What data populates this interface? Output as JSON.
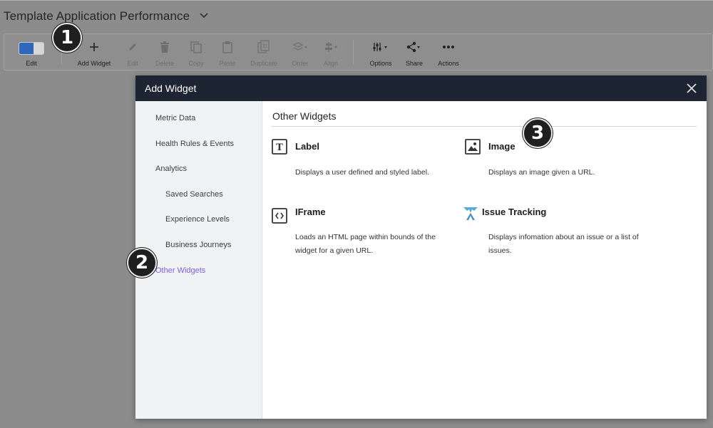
{
  "page": {
    "title": "Template Application Performance"
  },
  "toolbar": {
    "edit_label": "Edit",
    "add_widget_label": "Add Widget",
    "edit2_label": "Edit",
    "delete_label": "Delete",
    "copy_label": "Copy",
    "paste_label": "Paste",
    "duplicate_label": "Duplicate",
    "order_label": "Order",
    "align_label": "Align",
    "options_label": "Options",
    "share_label": "Share",
    "actions_label": "Actions"
  },
  "modal": {
    "title": "Add Widget",
    "sidebar": {
      "items": [
        {
          "label": "Metric Data"
        },
        {
          "label": "Health Rules & Events"
        },
        {
          "label": "Analytics"
        },
        {
          "label": "Saved Searches"
        },
        {
          "label": "Experience Levels"
        },
        {
          "label": "Business Journeys"
        },
        {
          "label": "Other Widgets",
          "active": true
        }
      ]
    },
    "section_title": "Other Widgets",
    "widgets": [
      {
        "name": "Label",
        "icon": "label-icon",
        "desc": "Displays a user defined and styled label."
      },
      {
        "name": "Image",
        "icon": "image-icon",
        "desc": "Displays an image given a URL."
      },
      {
        "name": "IFrame",
        "icon": "iframe-icon",
        "desc_line1": "Loads an HTML page within bounds of the",
        "desc_line2": "widget for a given URL."
      },
      {
        "name": "Issue Tracking",
        "icon": "issue-tracking-icon",
        "desc_line1": "Displays infomation about an issue or a list of",
        "desc_line2": "issues."
      }
    ]
  },
  "callouts": [
    "1",
    "2",
    "3"
  ],
  "colors": {
    "toggle_on": "#2e67bb",
    "modal_header": "#1d2532",
    "active_item": "#7a5fe0",
    "overlay": "#8c8c8c"
  }
}
